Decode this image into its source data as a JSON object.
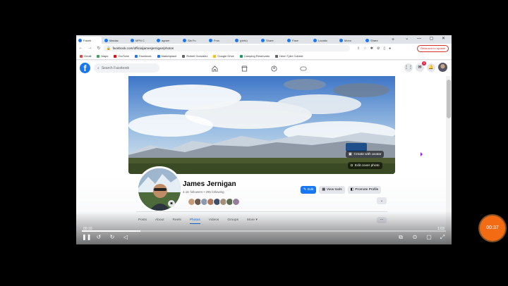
{
  "browser": {
    "tabs": [
      {
        "label": "Faceb",
        "active": true
      },
      {
        "label": "Maniac",
        "active": false
      },
      {
        "label": "MPN C",
        "active": false
      },
      {
        "label": "agram",
        "active": false
      },
      {
        "label": "Sla Fu",
        "active": false
      },
      {
        "label": "Frus",
        "active": false
      },
      {
        "label": "(pixiv)",
        "active": false
      },
      {
        "label": "Share",
        "active": false
      },
      {
        "label": "Face",
        "active": false
      },
      {
        "label": "Locatio",
        "active": false
      },
      {
        "label": "Mono",
        "active": false
      },
      {
        "label": "Share",
        "active": false
      }
    ],
    "new_tab_label": "+",
    "window_controls": "⌄ — ▢ ✕",
    "url": "facebook.com/officialjamesjernigan/photos",
    "update_label": "Relaunch to update",
    "bookmarks": [
      {
        "label": "Gmail",
        "color": "#ea4335"
      },
      {
        "label": "Maps",
        "color": "#34a853"
      },
      {
        "label": "YouTube",
        "color": "#ff0000"
      },
      {
        "label": "Facebook",
        "color": "#1877f2"
      },
      {
        "label": "Marketplace",
        "color": "#1877f2"
      },
      {
        "label": "Robert Gonzalez",
        "color": "#5f6368"
      },
      {
        "label": "Google Drive",
        "color": "#fbbc04"
      },
      {
        "label": "Camping Reservatio",
        "color": "#0f9d58"
      },
      {
        "label": "Henri Tyler Cubicle",
        "color": "#5f6368"
      }
    ]
  },
  "facebook": {
    "logo_letter": "f",
    "search_placeholder": "Search Facebook",
    "notifications_badge": "3",
    "profile": {
      "name": "James Jernigan",
      "followers_line": "4.1K followers • 295 following",
      "cover_buttons": {
        "create_with_avatar": "Create with avatar",
        "edit_cover": "Edit cover photo"
      },
      "actions": {
        "edit": "Edit",
        "view_tools": "View tools",
        "promote": "Promote Profile"
      },
      "friend_colors": [
        "#c49a7a",
        "#6b5a4e",
        "#8a9bb0",
        "#b0785c",
        "#3f4f6a",
        "#a58f7a",
        "#5c6e52",
        "#937f9c"
      ],
      "tabs": [
        "Posts",
        "About",
        "Reels",
        "Photos",
        "Videos",
        "Groups",
        "More ▾"
      ],
      "active_tab": "Photos"
    },
    "colors": {
      "brand": "#1877f2",
      "active_tab": "#1877f2"
    }
  },
  "video_player": {
    "elapsed": "00:10",
    "duration": "1:03",
    "progress_fraction": 0.16,
    "record_timer": "00:37"
  }
}
